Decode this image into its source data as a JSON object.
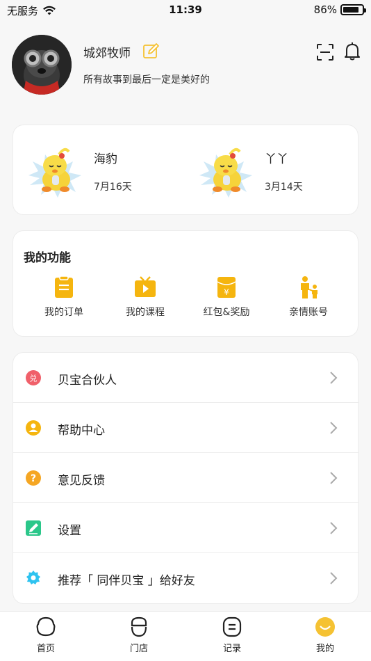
{
  "status_bar": {
    "carrier": "无服务",
    "time": "11:39",
    "battery": "86%",
    "battery_level": 0.86
  },
  "profile": {
    "name": "城郊牧师",
    "signature": "所有故事到最后一定是美好的"
  },
  "children": [
    {
      "name": "海豹",
      "age": "7月16天"
    },
    {
      "name": "丫丫",
      "age": "3月14天"
    }
  ],
  "functions": {
    "title": "我的功能",
    "items": [
      {
        "label": "我的订单",
        "icon": "order-icon"
      },
      {
        "label": "我的课程",
        "icon": "course-icon"
      },
      {
        "label": "红包&奖励",
        "icon": "red-packet-icon"
      },
      {
        "label": "亲情账号",
        "icon": "family-icon"
      }
    ]
  },
  "menu": {
    "items": [
      {
        "label": "贝宝合伙人",
        "icon": "partner-icon"
      },
      {
        "label": "帮助中心",
        "icon": "help-center-icon"
      },
      {
        "label": "意见反馈",
        "icon": "feedback-icon"
      },
      {
        "label": "设置",
        "icon": "settings-icon"
      },
      {
        "label": "推荐「 同伴贝宝 」给好友",
        "icon": "recommend-icon"
      }
    ]
  },
  "tabs": [
    {
      "label": "首页",
      "icon": "home-tab-icon"
    },
    {
      "label": "门店",
      "icon": "store-tab-icon"
    },
    {
      "label": "记录",
      "icon": "record-tab-icon"
    },
    {
      "label": "我的",
      "icon": "me-tab-icon",
      "active": true
    }
  ],
  "colors": {
    "accent": "#f5b50f",
    "partner_red": "#f0606a",
    "settings_green": "#2bc78a",
    "recommend_blue": "#2ec3f0"
  }
}
